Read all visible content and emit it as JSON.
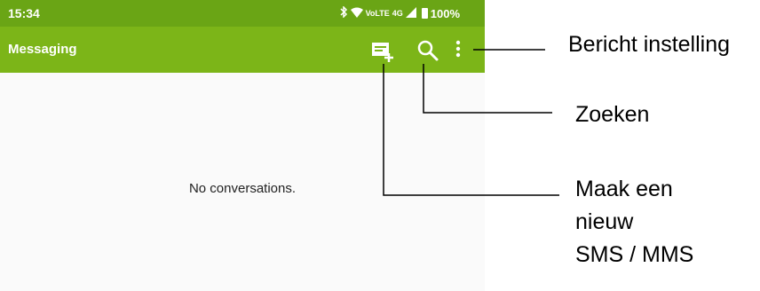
{
  "status_bar": {
    "time": "15:34",
    "bluetooth_icon": "bluetooth-icon",
    "wifi_icon": "wifi-icon",
    "volte": "VoLTE",
    "network": "4G",
    "signal_icon": "signal-icon",
    "battery": "100%"
  },
  "app_bar": {
    "title": "Messaging",
    "actions": [
      "new-message-icon",
      "search-icon",
      "more-vert-icon"
    ]
  },
  "main": {
    "empty_text": "No conversations."
  },
  "callouts": {
    "settings": "Bericht instelling",
    "search": "Zoeken",
    "new_line1": "Maak een",
    "new_line2": "nieuw",
    "new_line3": "SMS / MMS"
  },
  "colors": {
    "status_bar": "#6aa515",
    "app_bar": "#7cb518",
    "background": "#fafafa"
  }
}
